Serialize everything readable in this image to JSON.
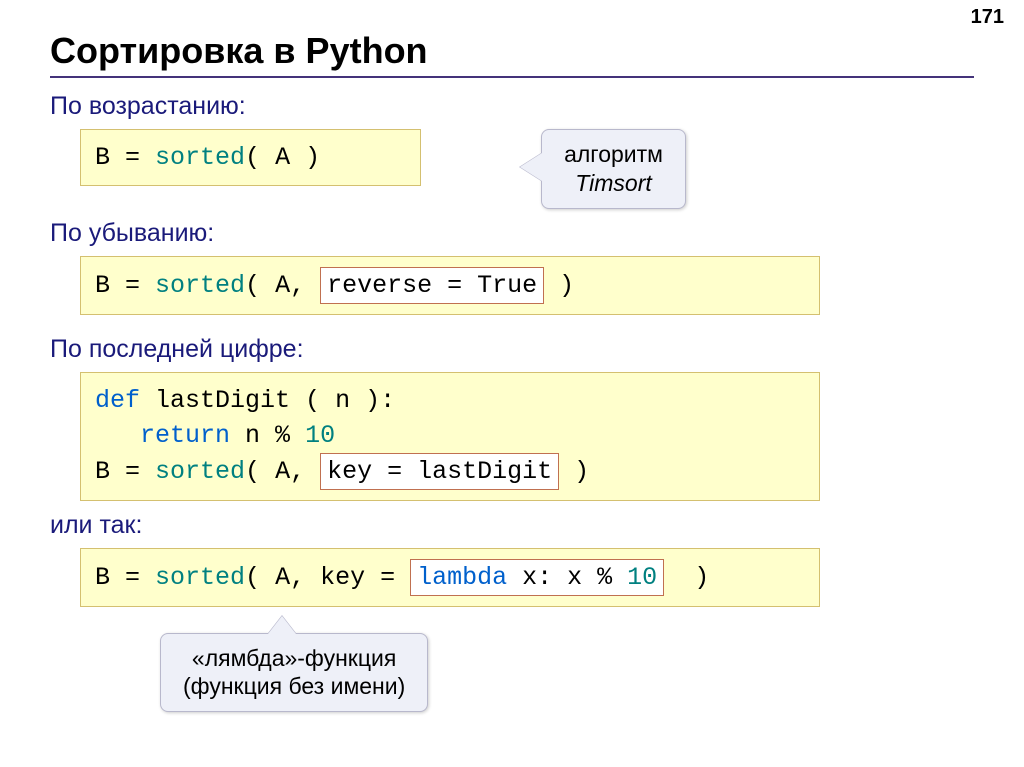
{
  "page_number": "171",
  "title": "Сортировка в Python",
  "sections": {
    "asc": {
      "label": "По возрастанию:",
      "code_b": "B",
      "code_eq": " = ",
      "code_sorted": "sorted",
      "code_open": "( ",
      "code_a": "A",
      "code_close": " )"
    },
    "callout_timsort": {
      "line1": "алгоритм",
      "line2": "Timsort"
    },
    "desc": {
      "label": "По убыванию:",
      "code_b": "B",
      "code_eq": " = ",
      "code_sorted": "sorted",
      "code_open": "( ",
      "code_a": "A",
      "code_comma": ", ",
      "inset_text": "reverse = True",
      "code_close": " )"
    },
    "lastdigit": {
      "label": "По последней цифре:",
      "def": "def",
      "fname": " lastDigit ",
      "paren_open": "( ",
      "param": "n",
      "paren_close": " ):",
      "ret": "return",
      "expr_n": " n",
      "expr_mod": " % ",
      "expr_10": "10",
      "b": "B",
      "eq": " = ",
      "sorted": "sorted",
      "open": "( ",
      "a": "A",
      "comma": ", ",
      "inset_text": "key = lastDigit",
      "close": " )"
    },
    "or": {
      "label": "или так:",
      "b": "B",
      "eq": " = ",
      "sorted": "sorted",
      "open": "( ",
      "a": "A",
      "comma": ", ",
      "key": "key",
      "eq2": " = ",
      "inset_lambda": "lambda",
      "inset_rest1": " x: x",
      "inset_mod": " % ",
      "inset_10": "10",
      "close": "  )"
    },
    "callout_lambda": {
      "line1": "«лямбда»-функция",
      "line2": "(функция без имени)"
    }
  }
}
